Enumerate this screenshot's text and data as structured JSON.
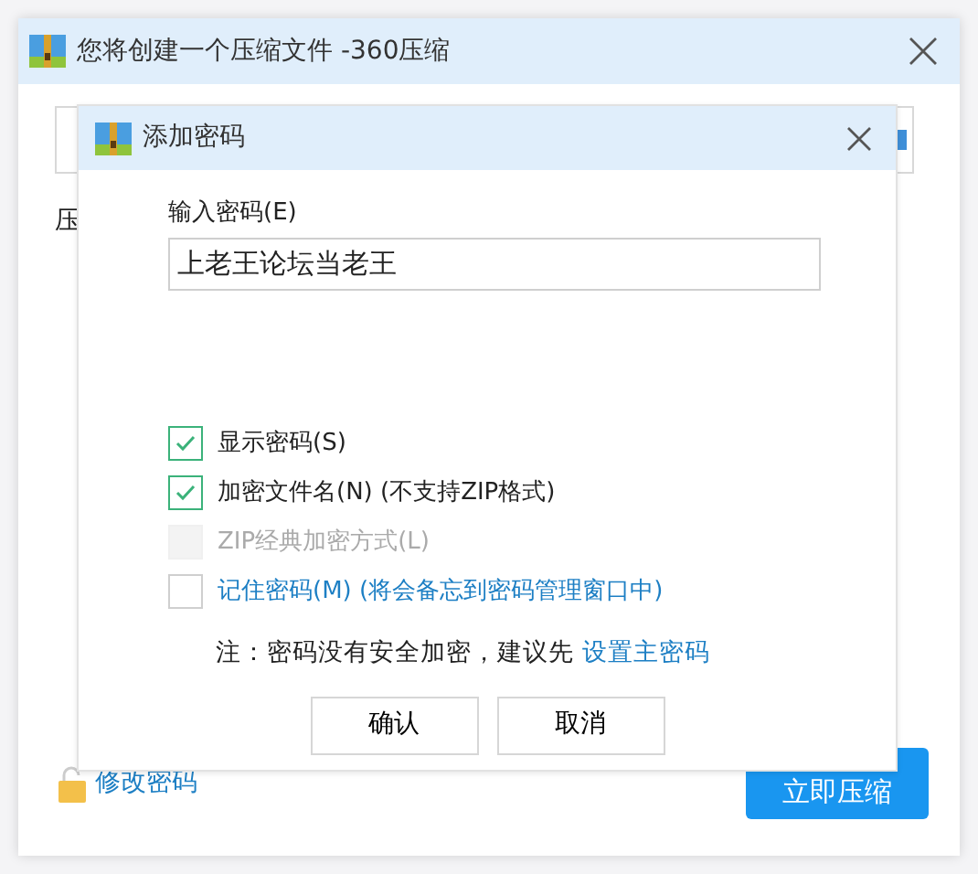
{
  "window": {
    "title": "您将创建一个压缩文件 -360压缩"
  },
  "background": {
    "label": "压",
    "link": "修改密码",
    "primary_button": "立即压缩"
  },
  "dialog": {
    "title": "添加密码",
    "password_label": "输入密码(E)",
    "password_value": "上老王论坛当老王",
    "options": [
      {
        "label": "显示密码(S)",
        "checked": true,
        "disabled": false,
        "kind": "plain"
      },
      {
        "label": "加密文件名(N) (不支持ZIP格式)",
        "checked": true,
        "disabled": false,
        "kind": "plain"
      },
      {
        "label": "ZIP经典加密方式(L)",
        "checked": false,
        "disabled": true,
        "kind": "plain"
      },
      {
        "label": "记住密码(M) (将会备忘到密码管理窗口中)",
        "checked": false,
        "disabled": false,
        "kind": "link"
      }
    ],
    "note": "注：密码没有安全加密，建议先",
    "note_link": "设置主密码",
    "buttons": [
      "确认",
      "取消"
    ]
  }
}
